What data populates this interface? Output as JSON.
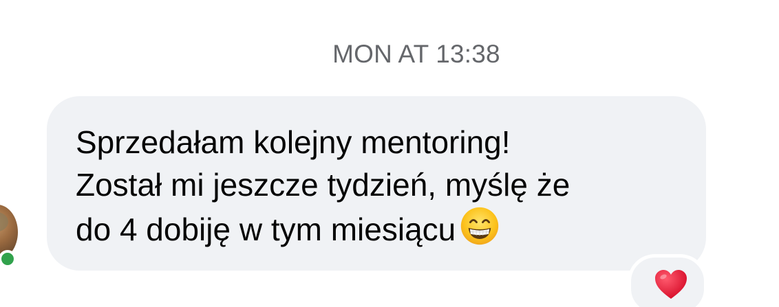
{
  "thread": {
    "timestamp": "MON AT 13:38"
  },
  "message": {
    "lines": [
      "Sprzedałam kolejny mentoring!",
      "Został mi jeszcze tydzień, myślę że",
      "do 4 dobiję w tym miesiącu"
    ],
    "emoji": "grinning-face-with-smiling-eyes-icon",
    "bubble_color": "#f0f2f5",
    "text_color": "#050505"
  },
  "reaction": {
    "icon": "heart-icon",
    "color": "#e41e3f"
  },
  "sender": {
    "avatar": "avatar",
    "online_color": "#31a24c"
  },
  "colors": {
    "timestamp": "#65676b"
  }
}
